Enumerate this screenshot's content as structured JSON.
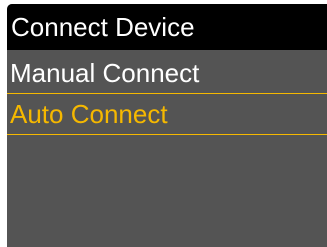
{
  "screen": {
    "title": "Connect Device"
  },
  "menu": {
    "items": [
      {
        "label": "Manual Connect",
        "selected": false
      },
      {
        "label": "Auto Connect",
        "selected": true
      }
    ]
  },
  "colors": {
    "title_bar_bg": "#000000",
    "screen_bg": "#545454",
    "text": "#ffffff",
    "selected_accent": "#f5b800"
  }
}
